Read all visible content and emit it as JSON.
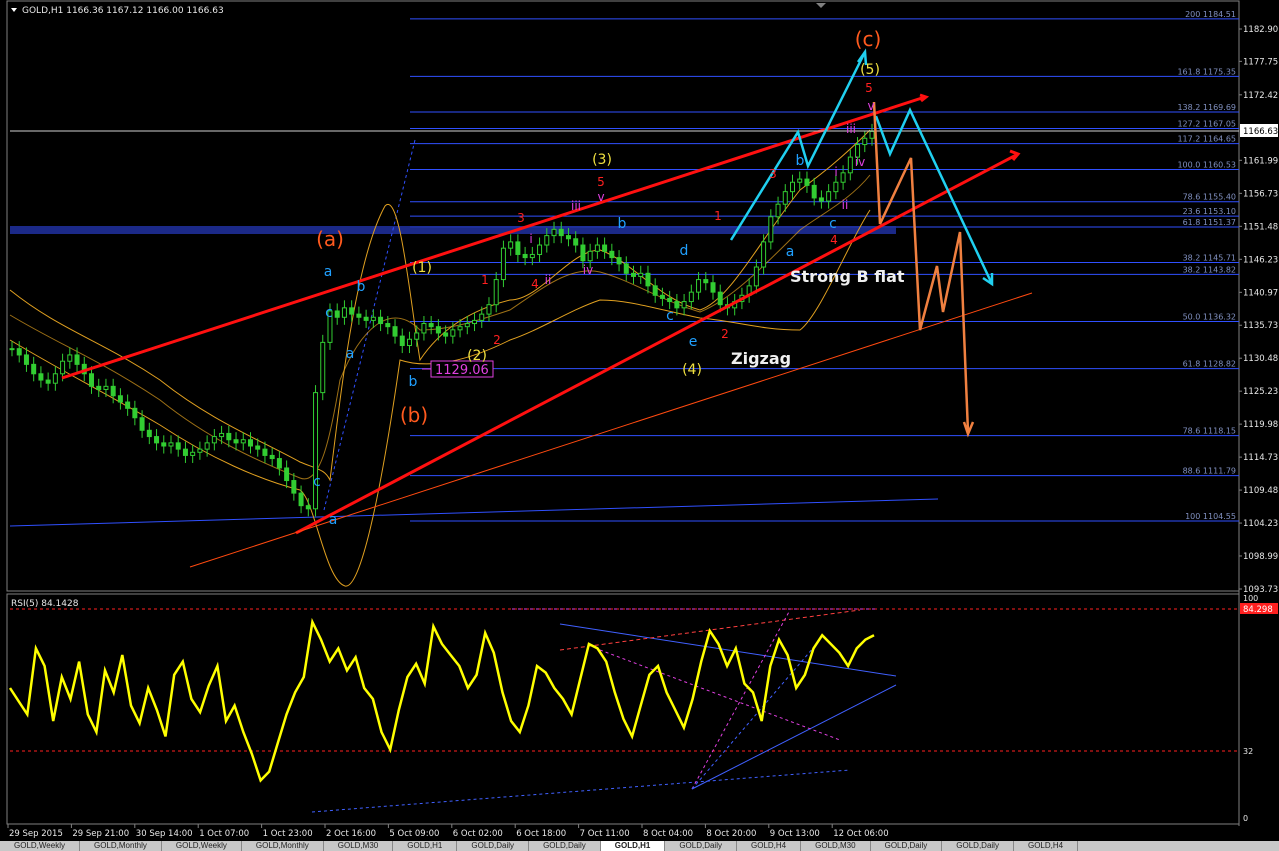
{
  "header": {
    "symbol_info": "GOLD,H1  1166.36 1167.12 1166.00 1166.63"
  },
  "colors": {
    "background": "#000000",
    "candles": "#32cd32",
    "bollinger": "#e0a020",
    "trend_red": "#ff1010",
    "fib_lines": "#3050ff",
    "cyan_arrows": "#20d0f0",
    "orange_arrows": "#f08040",
    "rsi_line": "#ffff00",
    "current_price_bg": "#ffffff",
    "rsi_level_bg": "#ff2020"
  },
  "chart_data": [
    {
      "type": "line",
      "title": "GOLD,H1",
      "ylim": [
        1093.73,
        1187.4
      ],
      "price_ticks": [
        "1182.90",
        "1177.75",
        "1172.42",
        "1166.63",
        "1161.99",
        "1156.73",
        "1151.48",
        "1146.23",
        "1140.97",
        "1135.73",
        "1130.48",
        "1125.23",
        "1119.98",
        "1114.73",
        "1109.48",
        "1104.23",
        "1098.99",
        "1093.73"
      ],
      "current_price": "1166.63",
      "time_labels": [
        "29 Sep 2015",
        "29 Sep 21:00",
        "30 Sep 14:00",
        "1 Oct 07:00",
        "1 Oct 23:00",
        "2 Oct 16:00",
        "5 Oct 09:00",
        "6 Oct 02:00",
        "6 Oct 18:00",
        "7 Oct 11:00",
        "8 Oct 04:00",
        "8 Oct 20:00",
        "9 Oct 13:00",
        "12 Oct 06:00"
      ],
      "fib_levels": [
        {
          "label": "200 1184.51",
          "price": 1184.51
        },
        {
          "label": "161.8 1175.35",
          "price": 1175.35
        },
        {
          "label": "138.2 1169.69",
          "price": 1169.69
        },
        {
          "label": "127.2 1167.05",
          "price": 1167.05
        },
        {
          "label": "117.2 1164.65",
          "price": 1164.65
        },
        {
          "label": "100.0 1160.53",
          "price": 1160.53
        },
        {
          "label": "78.6 1155.40",
          "price": 1155.4
        },
        {
          "label": "23.6 1153.10",
          "price": 1153.1
        },
        {
          "label": "61.8 1151.37",
          "price": 1151.37
        },
        {
          "label": "38.2 1145.71",
          "price": 1145.71
        },
        {
          "label": "38.2 1143.82",
          "price": 1143.82
        },
        {
          "label": "50.0 1136.32",
          "price": 1136.32
        },
        {
          "label": "61.8 1128.82",
          "price": 1128.82
        },
        {
          "label": "78.6 1118.15",
          "price": 1118.15
        },
        {
          "label": "88.6 1111.79",
          "price": 1111.79
        },
        {
          "label": "100 1104.55",
          "price": 1104.55
        }
      ],
      "price_box": "1129.06",
      "wave_labels": [
        {
          "text": "(c)",
          "color": "#ff5a1e",
          "size": 20
        },
        {
          "text": "(a)",
          "color": "#ff5a1e",
          "size": 20
        },
        {
          "text": "(b)",
          "color": "#ff5a1e",
          "size": 20
        },
        {
          "text": "(1)",
          "color": "#f0e040",
          "size": 14
        },
        {
          "text": "(2)",
          "color": "#f0e040",
          "size": 14
        },
        {
          "text": "(3)",
          "color": "#f0e040",
          "size": 14
        },
        {
          "text": "(4)",
          "color": "#f0e040",
          "size": 14
        },
        {
          "text": "(5)",
          "color": "#f0e040",
          "size": 14
        },
        {
          "text": "a",
          "color": "#20a0ff",
          "size": 14
        },
        {
          "text": "b",
          "color": "#20a0ff",
          "size": 14
        },
        {
          "text": "c",
          "color": "#20a0ff",
          "size": 14
        },
        {
          "text": "a",
          "color": "#20a0ff",
          "size": 14
        },
        {
          "text": "b",
          "color": "#20a0ff",
          "size": 14
        },
        {
          "text": "c",
          "color": "#20a0ff",
          "size": 14
        },
        {
          "text": "a",
          "color": "#20a0ff",
          "size": 14
        },
        {
          "text": "b",
          "color": "#20a0ff",
          "size": 14
        },
        {
          "text": "d",
          "color": "#20a0ff",
          "size": 14
        },
        {
          "text": "c",
          "color": "#20a0ff",
          "size": 14
        },
        {
          "text": "e",
          "color": "#20a0ff",
          "size": 14
        },
        {
          "text": "a",
          "color": "#20a0ff",
          "size": 14
        },
        {
          "text": "b",
          "color": "#20a0ff",
          "size": 14
        },
        {
          "text": "c",
          "color": "#20a0ff",
          "size": 14
        },
        {
          "text": "1",
          "color": "#ff2020",
          "size": 12
        },
        {
          "text": "2",
          "color": "#ff2020",
          "size": 12
        },
        {
          "text": "3",
          "color": "#ff2020",
          "size": 12
        },
        {
          "text": "4",
          "color": "#ff2020",
          "size": 12
        },
        {
          "text": "5",
          "color": "#ff2020",
          "size": 12
        },
        {
          "text": "1",
          "color": "#ff2020",
          "size": 12
        },
        {
          "text": "2",
          "color": "#ff2020",
          "size": 12
        },
        {
          "text": "3",
          "color": "#ff2020",
          "size": 12
        },
        {
          "text": "4",
          "color": "#ff2020",
          "size": 12
        },
        {
          "text": "5",
          "color": "#ff2020",
          "size": 12
        },
        {
          "text": "i",
          "color": "#e040e0",
          "size": 12
        },
        {
          "text": "ii",
          "color": "#e040e0",
          "size": 12
        },
        {
          "text": "iii",
          "color": "#e040e0",
          "size": 12
        },
        {
          "text": "iv",
          "color": "#e040e0",
          "size": 12
        },
        {
          "text": "v",
          "color": "#e040e0",
          "size": 12
        },
        {
          "text": "i",
          "color": "#e040e0",
          "size": 12
        },
        {
          "text": "ii",
          "color": "#e040e0",
          "size": 12
        },
        {
          "text": "iii",
          "color": "#e040e0",
          "size": 12
        },
        {
          "text": "iv",
          "color": "#e040e0",
          "size": 12
        },
        {
          "text": "v",
          "color": "#e040e0",
          "size": 12
        },
        {
          "text": "Strong B flat",
          "color": "#f0f0f0",
          "size": 16
        },
        {
          "text": "Zigzag",
          "color": "#f0f0f0",
          "size": 16
        }
      ],
      "series": [
        {
          "values": [
            1132.0,
            1131.0,
            1129.5,
            1128.0,
            1127.0,
            1126.5,
            1128.0,
            1130.0,
            1131.0,
            1129.5,
            1128.0,
            1126.0,
            1125.5,
            1126.0,
            1124.5,
            1123.5,
            1122.5,
            1121.0,
            1119.0,
            1118.0,
            1117.0,
            1116.5,
            1117.0,
            1116.0,
            1115.0,
            1115.5,
            1116.0,
            1117.0,
            1118.0,
            1118.5,
            1117.5,
            1117.0,
            1117.5,
            1116.5,
            1116.0,
            1115.0,
            1114.5,
            1113.0,
            1111.0,
            1109.0,
            1107.0,
            1106.5,
            1125.0,
            1133.0,
            1138.0,
            1137.0,
            1138.5,
            1137.5,
            1137.0,
            1136.5,
            1137.0,
            1136.0,
            1135.5,
            1134.0,
            1132.5,
            1133.5,
            1134.5,
            1136.0,
            1135.5,
            1134.5,
            1134.0,
            1135.0,
            1135.5,
            1136.0,
            1136.5,
            1137.5,
            1139.0,
            1143.0,
            1148.0,
            1149.0,
            1147.0,
            1146.5,
            1147.0,
            1148.5,
            1150.0,
            1151.0,
            1150.0,
            1149.5,
            1148.5,
            1146.0,
            1147.5,
            1148.5,
            1147.5,
            1146.5,
            1145.5,
            1144.0,
            1143.5,
            1144.0,
            1142.0,
            1140.5,
            1140.0,
            1139.5,
            1138.5,
            1139.5,
            1141.0,
            1143.0,
            1142.5,
            1141.0,
            1139.0,
            1138.5,
            1139.5,
            1140.5,
            1142.0,
            1145.0,
            1149.0,
            1153.0,
            1155.0,
            1157.0,
            1158.5,
            1159.0,
            1158.0,
            1156.0,
            1155.5,
            1157.0,
            1158.5,
            1160.0,
            1162.5,
            1164.5,
            1165.5,
            1166.6
          ]
        }
      ]
    },
    {
      "type": "line",
      "title": "RSI(5) 84.1428",
      "ylim": [
        0,
        100
      ],
      "levels": [
        32,
        84
      ],
      "level_marker": "84.298",
      "axis_ticks": [
        "100",
        "32",
        "0"
      ],
      "series": [
        {
          "values": [
            60,
            54,
            48,
            78,
            70,
            45,
            65,
            55,
            72,
            48,
            40,
            68,
            58,
            75,
            52,
            44,
            60,
            50,
            38,
            66,
            72,
            55,
            49,
            61,
            70,
            45,
            52,
            40,
            30,
            18,
            22,
            35,
            48,
            58,
            65,
            90,
            82,
            72,
            78,
            68,
            74,
            60,
            55,
            40,
            32,
            50,
            65,
            71,
            62,
            88,
            80,
            75,
            70,
            60,
            66,
            85,
            76,
            58,
            45,
            40,
            52,
            70,
            67,
            60,
            55,
            48,
            64,
            80,
            78,
            72,
            58,
            46,
            38,
            52,
            66,
            70,
            58,
            50,
            42,
            55,
            72,
            86,
            80,
            70,
            78,
            62,
            58,
            45,
            70,
            82,
            75,
            60,
            66,
            78,
            84,
            80,
            76,
            70,
            78,
            82,
            84
          ]
        }
      ]
    }
  ],
  "tabs": [
    "GOLD,Weekly",
    "GOLD,Monthly",
    "GOLD,Weekly",
    "GOLD,Monthly",
    "GOLD,M30",
    "GOLD,H1",
    "GOLD,Daily",
    "GOLD,Daily",
    "GOLD,H1",
    "GOLD,Daily",
    "GOLD,H4",
    "GOLD,M30",
    "GOLD,Daily",
    "GOLD,Daily",
    "GOLD,H4"
  ],
  "active_tab": 8
}
